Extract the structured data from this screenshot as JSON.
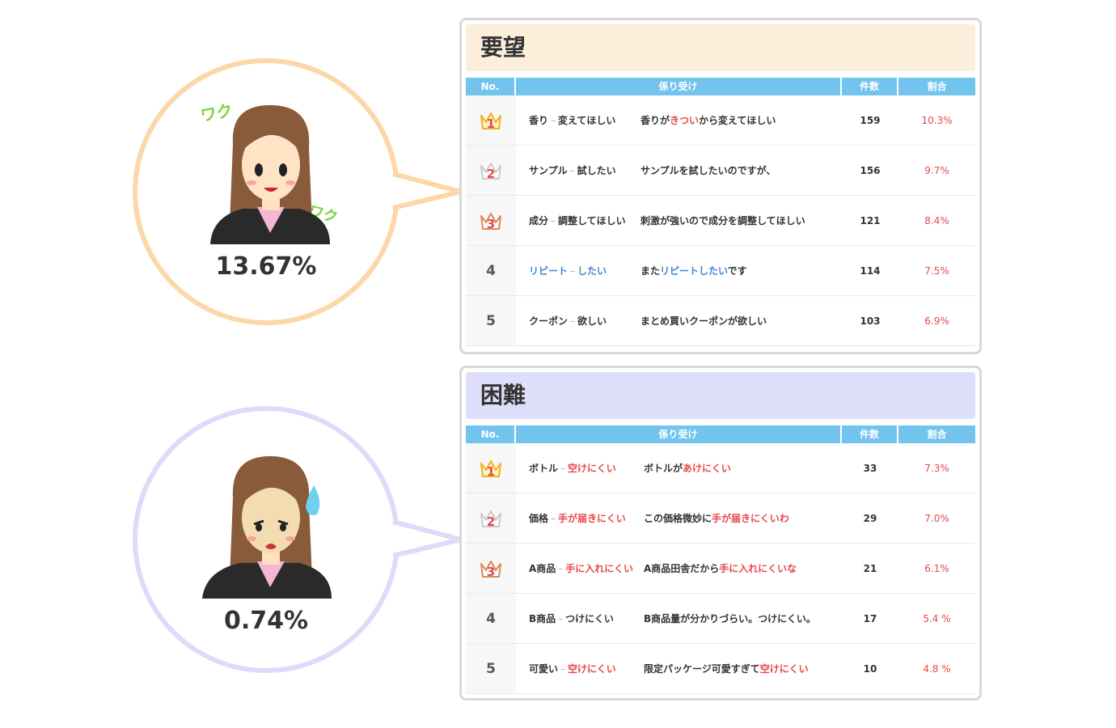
{
  "sections": [
    {
      "title": "要望",
      "percent": "13.67%",
      "headers": [
        "No.",
        "係り受け",
        "件数",
        "割合"
      ],
      "rows": [
        {
          "rank": "1",
          "kw_a": "香り",
          "kw_b": "変えてほしい",
          "sent_pre": "香りが",
          "sent_hl": "きつい",
          "sent_post": "から変えてほしい",
          "hl": "red",
          "count": "159",
          "rate": "10.3%"
        },
        {
          "rank": "2",
          "kw_a": "サンプル",
          "kw_b": "試したい",
          "sent_pre": "サンプルを試したいのですが、",
          "sent_hl": "",
          "sent_post": "",
          "hl": "red",
          "count": "156",
          "rate": "9.7%"
        },
        {
          "rank": "3",
          "kw_a": "成分",
          "kw_b": "調整してほしい",
          "sent_pre": "刺激が強いので成分を調整してほしい",
          "sent_hl": "",
          "sent_post": "",
          "hl": "red",
          "count": "121",
          "rate": "8.4%"
        },
        {
          "rank": "4",
          "kw_a": "リピート",
          "kw_b": "したい",
          "kw_color": "blue",
          "sent_pre": "また",
          "sent_hl": "リピートしたい",
          "sent_post": "です",
          "hl": "blue",
          "count": "114",
          "rate": "7.5%"
        },
        {
          "rank": "5",
          "kw_a": "クーポン",
          "kw_b": "欲しい",
          "sent_pre": "まとめ買いクーポンが欲しい",
          "sent_hl": "",
          "sent_post": "",
          "hl": "red",
          "count": "103",
          "rate": "6.9%"
        }
      ]
    },
    {
      "title": "困難",
      "percent": "0.74%",
      "headers": [
        "No.",
        "係り受け",
        "件数",
        "割合"
      ],
      "rows": [
        {
          "rank": "1",
          "kw_a": "ボトル",
          "kw_b": "空けにくい",
          "kw_b_color": "red",
          "sent_pre": "ボトルが",
          "sent_hl": "あけにくい",
          "sent_post": "",
          "hl": "red",
          "count": "33",
          "rate": "7.3%"
        },
        {
          "rank": "2",
          "kw_a": "価格",
          "kw_b": "手が届きにくい",
          "kw_b_color": "red",
          "sent_pre": "この価格微妙に",
          "sent_hl": "手が届きにくいわ",
          "sent_post": "",
          "hl": "red",
          "count": "29",
          "rate": "7.0%"
        },
        {
          "rank": "3",
          "kw_a": "A商品",
          "kw_b": "手に入れにくい",
          "kw_b_color": "red",
          "sent_pre": "A商品田舎だから",
          "sent_hl": "手に入れにくいな",
          "sent_post": "",
          "hl": "red",
          "count": "21",
          "rate": "6.1%"
        },
        {
          "rank": "4",
          "kw_a": "B商品",
          "kw_b": "つけにくい",
          "sent_pre": "B商品量が分かりづらい。つけにくい。",
          "sent_hl": "",
          "sent_post": "",
          "hl": "red",
          "count": "17",
          "rate": "5.4 %"
        },
        {
          "rank": "5",
          "kw_a": "可愛い",
          "kw_b": "空けにくい",
          "kw_b_color": "red",
          "sent_pre": "限定パッケージ可愛すぎて",
          "sent_hl": "空けにくい",
          "sent_post": "",
          "hl": "red",
          "count": "10",
          "rate": "4.8 %"
        }
      ]
    }
  ],
  "decor": {
    "excited_text": "ワク",
    "excited_text_2": "ワク"
  },
  "colors": {
    "header_blue": "#72c3ee",
    "accent_red": "#e8474a",
    "accent_blue": "#3f87d6",
    "peach": "#fdeddb",
    "lavender": "#dfdffc",
    "gold": "#f2b01e"
  }
}
